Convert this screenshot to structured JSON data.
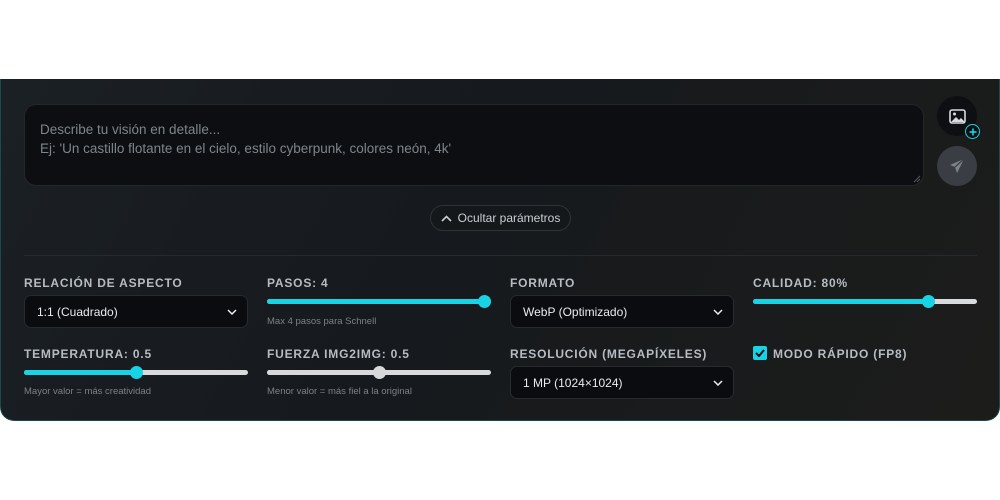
{
  "prompt": {
    "placeholder_line1": "Describe tu visión en detalle...",
    "placeholder_line2": "Ej: 'Un castillo flotante en el cielo, estilo cyberpunk, colores neón, 4k'"
  },
  "toggle_params_label": "Ocultar parámetros",
  "params": {
    "aspect_ratio": {
      "label": "RELACIÓN DE ASPECTO",
      "value": "1:1 (Cuadrado)"
    },
    "steps": {
      "label": "PASOS: 4",
      "hint": "Max 4 pasos para Schnell",
      "level": 1.0
    },
    "format": {
      "label": "FORMATO",
      "value": "WebP (Optimizado)"
    },
    "quality": {
      "label": "CALIDAD: 80%",
      "level": 0.78
    },
    "temperature": {
      "label": "TEMPERATURA: 0.5",
      "hint": "Mayor valor = más creatividad",
      "level": 0.5
    },
    "img2img_strength": {
      "label": "FUERZA IMG2IMG: 0.5",
      "hint": "Menor valor = más fiel a la original",
      "level": 0.5
    },
    "resolution": {
      "label": "RESOLUCIÓN (MEGAPÍXELES)",
      "value": "1 MP (1024×1024)"
    },
    "fast_mode": {
      "label": "MODO RÁPIDO (FP8)",
      "checked": true
    }
  },
  "colors": {
    "accent": "#18d3e4",
    "neutral_slider": "#d6d8da",
    "panel_bg": "#181c20"
  },
  "icons": {
    "upload": "image-plus-icon",
    "send": "paper-plane-icon",
    "toggle": "chevron-up-icon",
    "select": "chevron-down-icon"
  }
}
